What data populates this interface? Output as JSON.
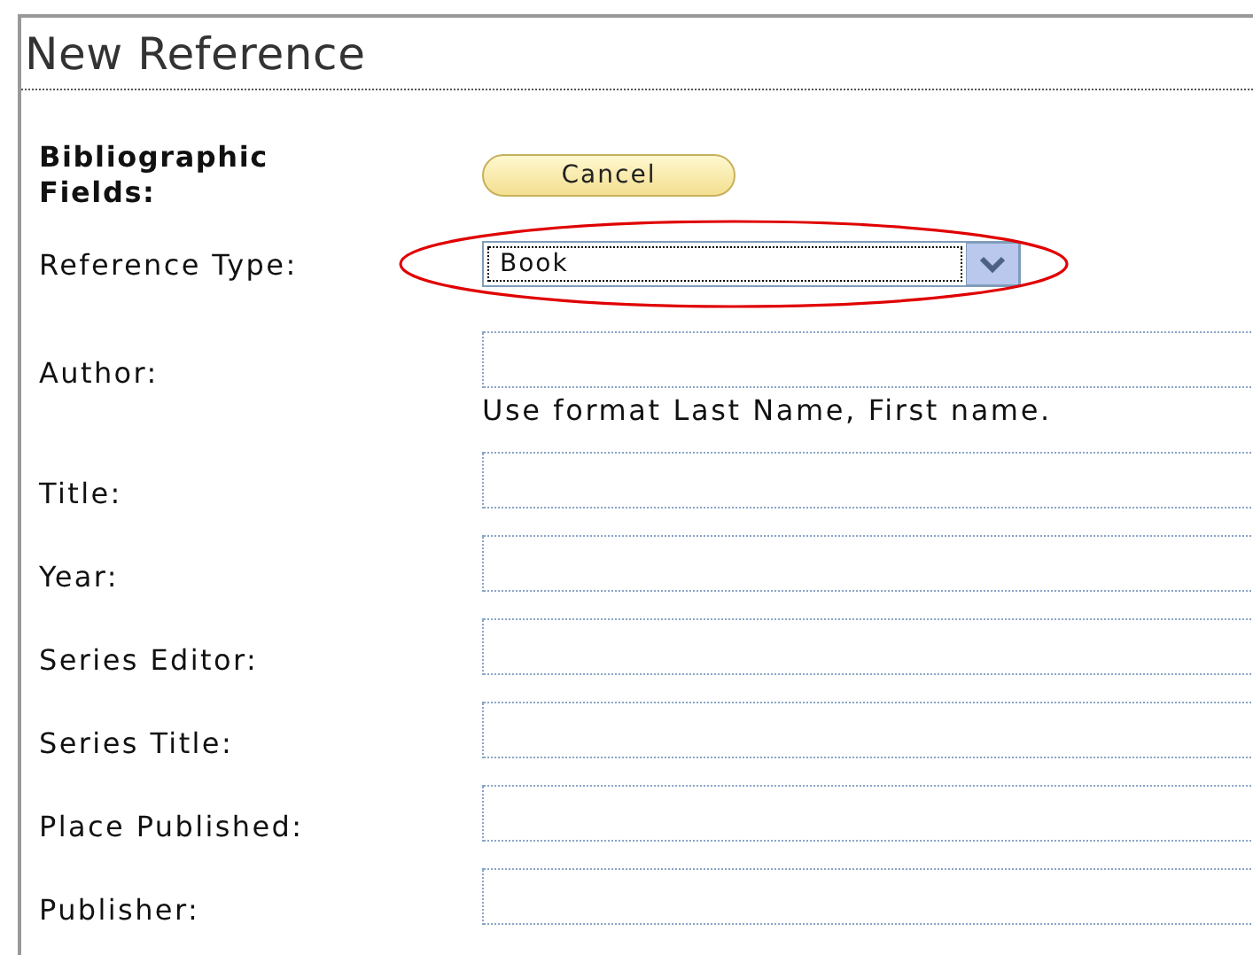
{
  "heading": "New Reference",
  "section": {
    "label": "Bibliographic Fields:",
    "button": "Cancel"
  },
  "reference_type": {
    "label": "Reference Type:",
    "value": "Book"
  },
  "fields": [
    {
      "label": "Author:",
      "hint": "Use format Last Name, First name."
    },
    {
      "label": "Title:"
    },
    {
      "label": "Year:"
    },
    {
      "label": "Series Editor:"
    },
    {
      "label": "Series Title:"
    },
    {
      "label": "Place Published:"
    },
    {
      "label": "Publisher:"
    }
  ]
}
